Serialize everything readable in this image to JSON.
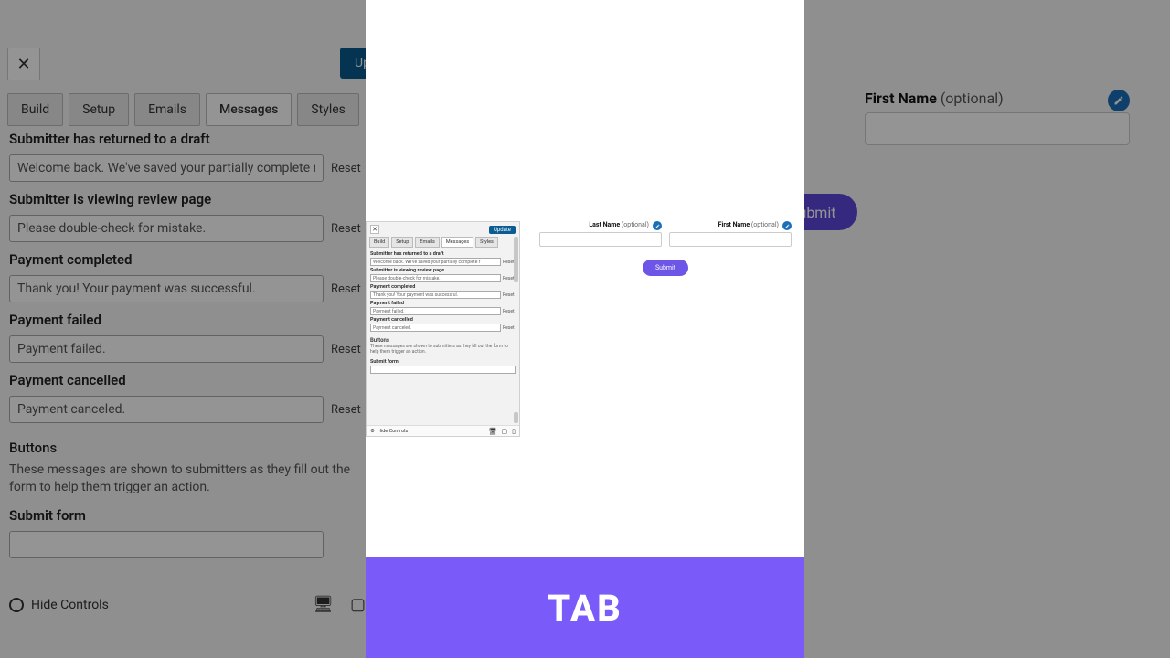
{
  "editor": {
    "close_label": "✕",
    "update_label": "Update",
    "tabs": [
      "Build",
      "Setup",
      "Emails",
      "Messages",
      "Styles"
    ],
    "active_tab": "Messages",
    "sections": {
      "returned_draft": {
        "title": "Submitter has returned to a draft",
        "value": "Welcome back. We've saved your partially complete re",
        "reset": "Reset"
      },
      "review_page": {
        "title": "Submitter is viewing review page",
        "value": "Please double-check for mistake.",
        "reset": "Reset"
      },
      "payment_completed": {
        "title": "Payment completed",
        "value": "Thank you! Your payment was successful.",
        "reset": "Reset"
      },
      "payment_failed": {
        "title": "Payment failed",
        "value": "Payment failed.",
        "reset": "Reset"
      },
      "payment_cancelled": {
        "title": "Payment cancelled",
        "value": "Payment canceled.",
        "reset": "Reset"
      }
    },
    "buttons_section": {
      "heading": "Buttons",
      "description": "These messages are shown to submitters as they fill out the form to help them trigger an action.",
      "submit_label": "Submit form"
    },
    "footer": {
      "hide_controls": "Hide Controls"
    }
  },
  "preview": {
    "last_name": {
      "label": "Last Name",
      "optional": "(optional)"
    },
    "first_name": {
      "label": "First Name",
      "optional": "(optional)"
    },
    "submit": "Submit"
  },
  "mini": {
    "returned_draft_value": "Welcome back. We've saved your partially complete r",
    "review_value": "Please double-check for mistake.",
    "payment_completed_value": "Thank you! Your payment was successful.",
    "payment_failed_value": "Payment failed.",
    "payment_cancelled_value": "Payment canceled."
  },
  "banner": {
    "text": "TAB"
  }
}
